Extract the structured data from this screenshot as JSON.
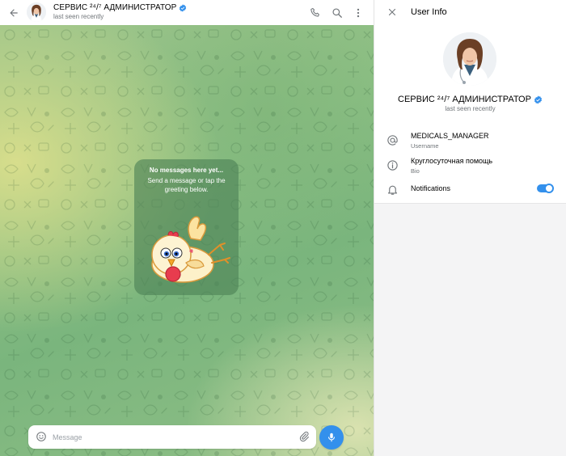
{
  "chat": {
    "name": "СЕРВИС ²⁴/⁷ АДМИНИСТРАТОР",
    "status": "last seen recently",
    "empty": {
      "title": "No messages here yet...",
      "subtitle": "Send a message or tap the greeting below."
    },
    "composer": {
      "placeholder": "Message"
    }
  },
  "info": {
    "title": "User Info",
    "name": "СЕРВИС ²⁴/⁷ АДМИНИСТРАТОР",
    "status": "last seen recently",
    "username": {
      "value": "MEDICALS_MANAGER",
      "label": "Username"
    },
    "bio": {
      "value": "Круглосуточная помощь",
      "label": "Bio"
    },
    "notifications": {
      "label": "Notifications",
      "enabled": true
    }
  },
  "colors": {
    "accent": "#3390ec",
    "secondary_text": "#707579"
  },
  "icons": [
    "back-arrow-icon",
    "verified-badge-icon",
    "phone-icon",
    "search-icon",
    "more-vertical-icon",
    "close-icon",
    "at-sign-icon",
    "info-icon",
    "bell-icon",
    "emoji-icon",
    "attach-icon",
    "microphone-icon"
  ]
}
